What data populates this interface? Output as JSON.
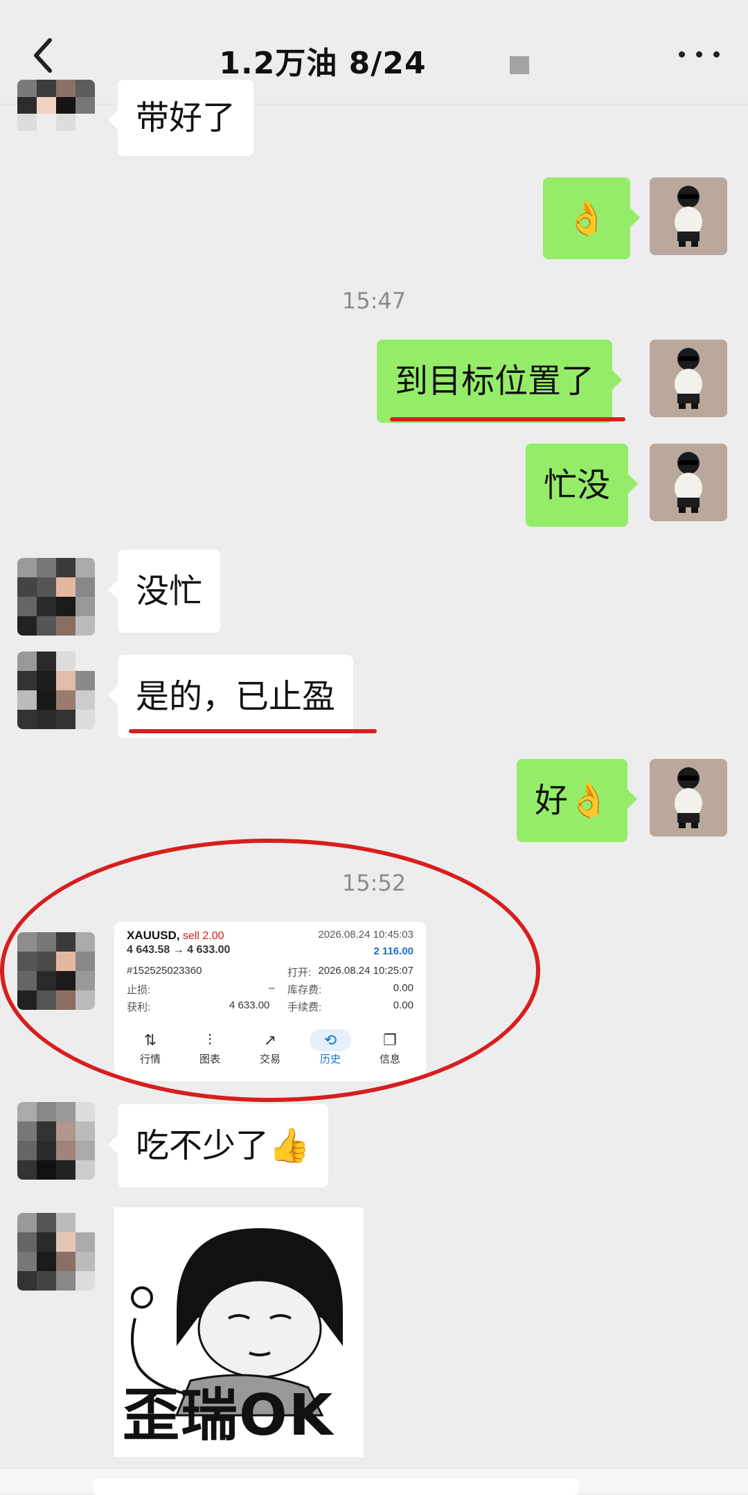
{
  "header": {
    "title": "1.2万油  8/24"
  },
  "messages": {
    "m1": "带好了",
    "m2": "👌",
    "t1": "15:47",
    "m3": "到目标位置了",
    "m4": "忙没",
    "m5": "没忙",
    "m6": "是的，已止盈",
    "m7": "好👌",
    "t2": "15:52",
    "m8": "吃不少了👍",
    "sticker_text": "歪瑞OK"
  },
  "trade_card": {
    "symbol": "XAUUSD,",
    "side": "sell 2.00",
    "price_change": "4 643.58 → 4 633.00",
    "close_time": "2026.08.24 10:45:03",
    "profit_total": "2 116.00",
    "order_id": "#152525023360",
    "open_label": "打开:",
    "open_time": "2026.08.24 10:25:07",
    "stop_loss_label": "止损:",
    "stop_loss_value": "–",
    "swap_label": "库存费:",
    "swap_value": "0.00",
    "take_profit_label": "获利:",
    "take_profit_value": "4 633.00",
    "fee_label": "手续费:",
    "fee_value": "0.00",
    "tabs": [
      "行情",
      "图表",
      "交易",
      "历史",
      "信息"
    ]
  },
  "colors": {
    "out_bubble": "#95ec69",
    "in_bubble": "#ffffff",
    "annotation_red": "#d81e1e",
    "accent_blue": "#1a6fc9"
  }
}
